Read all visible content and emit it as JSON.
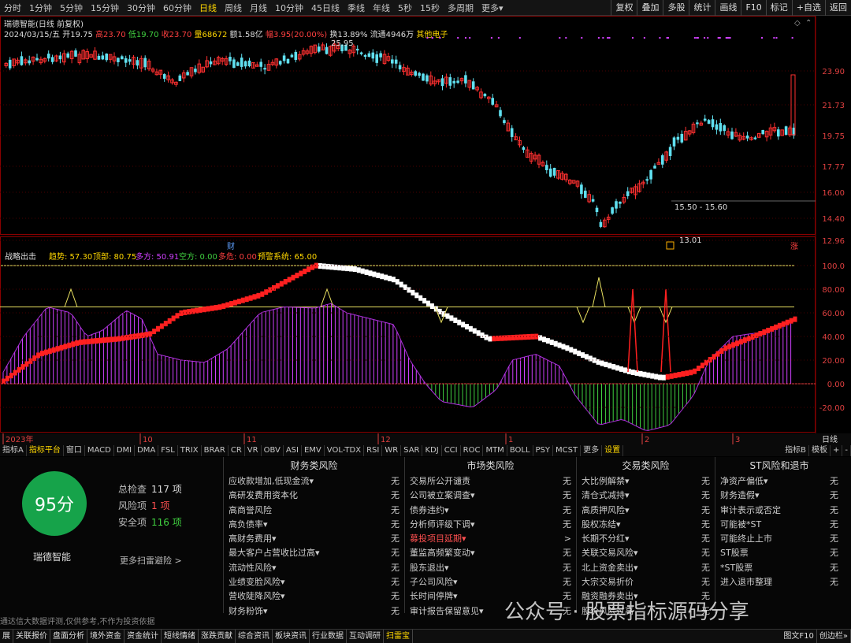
{
  "toolbar": {
    "periods": [
      "分时",
      "1分钟",
      "5分钟",
      "15分钟",
      "30分钟",
      "60分钟",
      "日线",
      "周线",
      "月线",
      "10分钟",
      "45日线",
      "季线",
      "年线",
      "5秒",
      "15秒",
      "多周期",
      "更多▾"
    ],
    "active": "日线",
    "right": [
      "复权",
      "叠加",
      "多股",
      "统计",
      "画线",
      "F10",
      "标记",
      "+自选",
      "返回"
    ]
  },
  "stock": {
    "title": "瑞德智能(日线 前复权)",
    "date": "2024/03/15/五",
    "open": "开19.75",
    "high": "高23.70",
    "low": "低19.70",
    "close": "收23.70",
    "volume": "量68672",
    "amount": "额1.58亿",
    "change": "幅3.95(20.00%)",
    "turnover": "换13.89%",
    "float": "流通4946万",
    "sector": "其他电子"
  },
  "chart": {
    "price_ticks": [
      "23.90",
      "21.73",
      "19.75",
      "17.77",
      "16.00",
      "14.40",
      "12.96"
    ],
    "annot_high": "25.95",
    "annot_low": "13.01",
    "annot_range": "15.50 - 15.60",
    "tag_cai": "财",
    "tag_zhang": "涨",
    "colors": {
      "up": "#ff3030",
      "down": "#60e0f0",
      "purple": "#d040ff",
      "green": "#40d040",
      "yellow": "#e8e060"
    }
  },
  "indicator": {
    "name": "战略出击",
    "trend": "趋势: 57.30",
    "top": "顶部: 80.75",
    "long": "多方: 50.91",
    "short": "空方: 0.00",
    "danger": "多危: 0.00",
    "warn": "预警系统: 65.00",
    "ticks": [
      "100.0",
      "80.00",
      "60.00",
      "40.00",
      "20.00",
      "0.00",
      "-20.00"
    ]
  },
  "timeaxis": {
    "labels": [
      "2023年",
      "10",
      "11",
      "12",
      "1",
      "2",
      "3"
    ],
    "right": "日线"
  },
  "ind_tabs": [
    "指标A",
    "指标平台",
    "窗口",
    "MACD",
    "DMI",
    "DMA",
    "FSL",
    "TRIX",
    "BRAR",
    "CR",
    "VR",
    "OBV",
    "ASI",
    "EMV",
    "VOL-TDX",
    "RSI",
    "WR",
    "SAR",
    "KDJ",
    "CCI",
    "ROC",
    "MTM",
    "BOLL",
    "PSY",
    "MCST",
    "更多",
    "设置"
  ],
  "ind_tabs_right": [
    "指标B",
    "模板",
    "+",
    "-"
  ],
  "risk": {
    "score": "95分",
    "name": "瑞德智能",
    "total_label": "总检查",
    "total": "117 项",
    "risk_label": "风险项",
    "risk_count": "1 项",
    "safe_label": "安全项",
    "safe_count": "116 项",
    "more": "更多扫雷避险 >",
    "disclaimer": "通达信大数据评测,仅供参考,不作为投资依据",
    "columns": [
      {
        "title": "财务类风险",
        "items": [
          [
            "应收款增加,低现金流▾",
            "无"
          ],
          [
            "高研发费用资本化",
            "无"
          ],
          [
            "高商誉风险",
            "无"
          ],
          [
            "高负债率▾",
            "无"
          ],
          [
            "高财务费用▾",
            "无"
          ],
          [
            "最大客户占营收比过高▾",
            "无"
          ],
          [
            "流动性风险▾",
            "无"
          ],
          [
            "业绩变脸风险▾",
            "无"
          ],
          [
            "营收陡降风险▾",
            "无"
          ],
          [
            "财务粉饰▾",
            "无"
          ]
        ]
      },
      {
        "title": "市场类风险",
        "items": [
          [
            "交易所公开谴责",
            "无"
          ],
          [
            "公司被立案调查▾",
            "无"
          ],
          [
            "债券违约▾",
            "无"
          ],
          [
            "分析师评级下调▾",
            "无"
          ],
          [
            "募投项目延期▾",
            ">"
          ],
          [
            "董监高频繁变动▾",
            "无"
          ],
          [
            "股东退出▾",
            "无"
          ],
          [
            "子公司风险▾",
            "无"
          ],
          [
            "长时间停牌▾",
            "无"
          ],
          [
            "审计报告保留意见▾",
            "无"
          ]
        ]
      },
      {
        "title": "交易类风险",
        "items": [
          [
            "大比例解禁▾",
            "无"
          ],
          [
            "清仓式减持▾",
            "无"
          ],
          [
            "高质押风险▾",
            "无"
          ],
          [
            "股权冻结▾",
            "无"
          ],
          [
            "长期不分红▾",
            "无"
          ],
          [
            "关联交易风险▾",
            "无"
          ],
          [
            "北上资金卖出▾",
            "无"
          ],
          [
            "大宗交易折价",
            "无"
          ],
          [
            "融资融券卖出▾",
            "无"
          ],
          [
            "股价风险过高",
            "无"
          ]
        ]
      },
      {
        "title": "ST风险和退市",
        "items": [
          [
            "净资产偏低▾",
            "无"
          ],
          [
            "财务造假▾",
            "无"
          ],
          [
            "审计表示或否定",
            "无"
          ],
          [
            "可能被*ST",
            "无"
          ],
          [
            "可能终止上市",
            "无"
          ],
          [
            "ST股票",
            "无"
          ],
          [
            "*ST股票",
            "无"
          ],
          [
            "进入退市整理",
            "无"
          ]
        ]
      }
    ],
    "watermark": "公众号 · 股票指标源码分享"
  },
  "status": {
    "items": [
      "展",
      "关联报价",
      "盘面分析",
      "境外资金",
      "资金统计",
      "短线情绪",
      "涨跌贡献",
      "综合资讯",
      "板块资讯",
      "行业数据",
      "互动调研",
      "扫雷宝"
    ],
    "right": [
      "图文F10",
      "创边栏»"
    ]
  }
}
